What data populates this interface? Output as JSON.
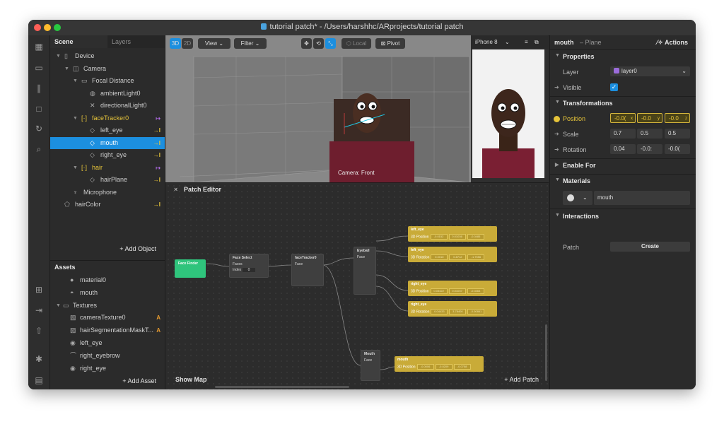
{
  "window": {
    "title": "tutorial patch* - /Users/harshhc/ARprojects/tutorial patch",
    "colors": {
      "close": "#ff5f57",
      "minimize": "#febc2e",
      "zoom": "#28c840",
      "accent": "#1c8fdf",
      "patch_yellow": "#c9ab38",
      "face_finder": "#2ecc71"
    }
  },
  "scene_panel": {
    "tabs": [
      "Scene",
      "Layers"
    ],
    "tree": [
      {
        "label": "Device",
        "indent": 0,
        "icon": "device-icon"
      },
      {
        "label": "Camera",
        "indent": 1,
        "icon": "camera-icon"
      },
      {
        "label": "Focal Distance",
        "indent": 2,
        "icon": "focal-distance-icon"
      },
      {
        "label": "ambientLight0",
        "indent": 3,
        "icon": "globe-icon"
      },
      {
        "label": "directionalLight0",
        "indent": 3,
        "icon": "light-icon"
      },
      {
        "label": "faceTracker0",
        "indent": 2,
        "icon": "face-tracker-icon",
        "badge": "↦"
      },
      {
        "label": "left_eye",
        "indent": 3,
        "icon": "plane-icon",
        "badge": "→I"
      },
      {
        "label": "mouth",
        "indent": 3,
        "icon": "plane-icon",
        "badge": "→I",
        "selected": true
      },
      {
        "label": "right_eye",
        "indent": 3,
        "icon": "plane-icon",
        "badge": "→I"
      },
      {
        "label": "hair",
        "indent": 2,
        "icon": "face-tracker-icon",
        "badge": "↦"
      },
      {
        "label": "hairPlane",
        "indent": 3,
        "icon": "plane-icon",
        "badge": "→I"
      },
      {
        "label": "Microphone",
        "indent": 1,
        "icon": "microphone-icon"
      },
      {
        "label": "hairColor",
        "indent": 0,
        "icon": "hair-color-icon",
        "badge": "→I"
      }
    ],
    "add_object": "+ Add Object"
  },
  "assets_panel": {
    "title": "Assets",
    "items": [
      {
        "label": "material0",
        "icon": "material-sphere-icon"
      },
      {
        "label": "mouth",
        "icon": "mouth-material-icon"
      },
      {
        "label": "Textures",
        "icon": "folder-icon"
      },
      {
        "label": "cameraTexture0",
        "icon": "texture-icon",
        "badge": "A"
      },
      {
        "label": "hairSegmentationMaskT...",
        "icon": "texture-icon",
        "badge": "A"
      },
      {
        "label": "left_eye",
        "icon": "eye-texture-icon"
      },
      {
        "label": "right_eyebrow",
        "icon": "eyebrow-texture-icon"
      },
      {
        "label": "right_eye",
        "icon": "eye-texture-icon"
      }
    ],
    "add_asset": "+ Add Asset"
  },
  "viewport": {
    "mode_3d": "3D",
    "mode_2d": "2D",
    "view_menu": "View",
    "filter_menu": "Filter",
    "local_label": "Local",
    "pivot_label": "Pivot",
    "camera_label": "Camera: Front"
  },
  "preview": {
    "device": "iPhone 8"
  },
  "patch_editor": {
    "title": "Patch Editor",
    "show_map": "Show Map",
    "add_patch": "+ Add Patch",
    "nodes": {
      "face_finder": "Face Finder",
      "face_select": "Face Select",
      "face_select_ports": [
        "Faces",
        "Index"
      ],
      "face_select_index": "0",
      "face_tracker": "faceTracker0",
      "face_tracker_ports": [
        "Face"
      ],
      "eyeball": "Eyeball",
      "eyeball_ports": [
        "Face"
      ],
      "mouth": "Mouth",
      "mouth_ports": [
        "Face"
      ]
    },
    "yellow_nodes": [
      {
        "title": "left_eye",
        "port": "3D Position",
        "values": [
          "-0.0152",
          "0.01036",
          "-0.0485"
        ]
      },
      {
        "title": "left_eye",
        "port": "3D Rotation",
        "values": [
          "0.0010",
          "0.8712",
          "-1.7556"
        ]
      },
      {
        "title": "right_eye",
        "port": "3D Position",
        "values": [
          "0.03422",
          "0.01037",
          "-0.0464"
        ]
      },
      {
        "title": "right_eye",
        "port": "3D Rotation",
        "values": [
          "0.04433",
          "3.78400",
          "-0.00861"
        ]
      },
      {
        "title": "mouth",
        "port": "3D Position",
        "values": [
          "-0.0006",
          "-0.0209",
          "-0.0758"
        ]
      }
    ]
  },
  "properties": {
    "object_name": "mouth",
    "object_type": "– Plane",
    "actions": "Actions",
    "sections": {
      "properties": "Properties",
      "transformations": "Transformations",
      "enable_for": "Enable For",
      "materials": "Materials",
      "interactions": "Interactions"
    },
    "layer_label": "Layer",
    "layer_value": "layer0",
    "visible_label": "Visible",
    "position_label": "Position",
    "position": [
      "-0.0(",
      "-0.0",
      "-0.0"
    ],
    "position_axes": [
      "x",
      "y",
      "z"
    ],
    "scale_label": "Scale",
    "scale": [
      "0.7",
      "0.5",
      "0.5"
    ],
    "rotation_label": "Rotation",
    "rotation": [
      "0.04",
      "-0.0:",
      "-0.0("
    ],
    "material_value": "mouth",
    "patch_label": "Patch",
    "create_button": "Create"
  }
}
